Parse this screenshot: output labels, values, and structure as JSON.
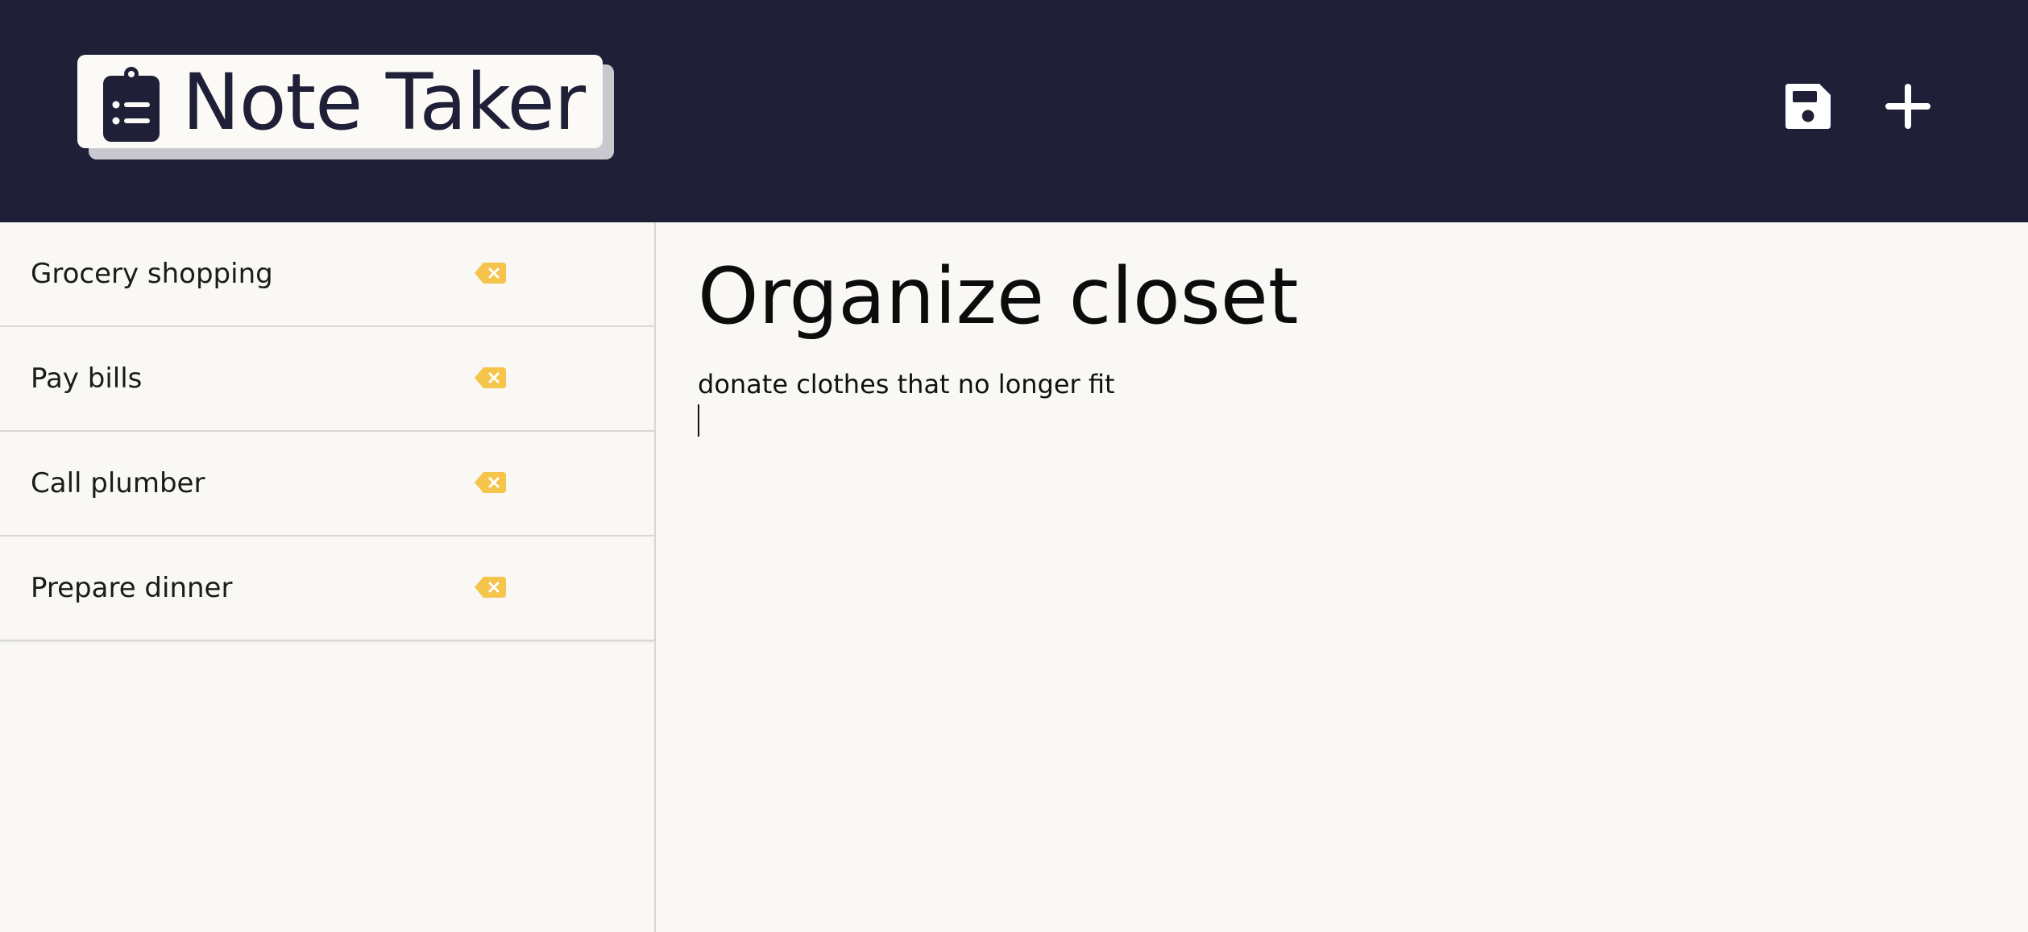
{
  "app": {
    "title": "Note Taker"
  },
  "header": {
    "brand_icon": "clipboard-list-icon",
    "actions": [
      {
        "name": "save",
        "icon": "floppy-disk-icon"
      },
      {
        "name": "new-note",
        "icon": "plus-icon"
      }
    ],
    "colors": {
      "background": "#1f1f38",
      "brand_bg": "#fbfaf6",
      "icon": "#ffffff"
    }
  },
  "sidebar": {
    "notes": [
      {
        "title": "Grocery shopping",
        "delete_icon": "backspace-x-icon"
      },
      {
        "title": "Pay bills",
        "delete_icon": "backspace-x-icon"
      },
      {
        "title": "Call plumber",
        "delete_icon": "backspace-x-icon"
      },
      {
        "title": "Prepare dinner",
        "delete_icon": "backspace-x-icon"
      }
    ],
    "delete_color": "#f5c44b"
  },
  "editor": {
    "title": "Organize closet",
    "body": "donate clothes that no longer fit"
  }
}
